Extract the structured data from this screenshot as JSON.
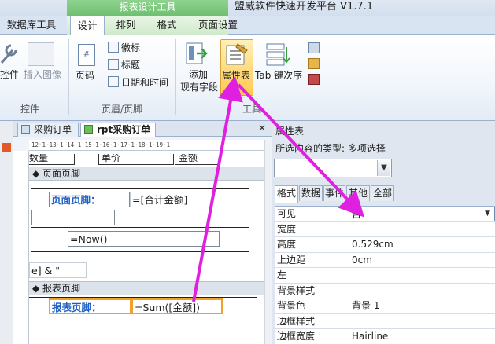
{
  "window": {
    "context_tab_group": "报表设计工具",
    "app_title": "盟威软件快速开发平台 V1.7.1"
  },
  "tabs": [
    {
      "label": "数据库工具"
    },
    {
      "label": "设计"
    },
    {
      "label": "排列"
    },
    {
      "label": "格式"
    },
    {
      "label": "页面设置"
    }
  ],
  "ribbon": {
    "controls_group": {
      "label": "控件",
      "items": [
        "控件",
        "插入图像"
      ]
    },
    "header_footer_group": {
      "label": "页眉/页脚",
      "page_number": "页码",
      "logo": "徽标",
      "title": "标题",
      "date_time": "日期和时间"
    },
    "tools_group": {
      "label": "工具",
      "add_field_line1": "添加",
      "add_field_line2": "现有字段",
      "property_sheet": "属性表",
      "tab_order": "Tab 键次序"
    }
  },
  "documents": {
    "tabs": [
      "采购订单",
      "rpt采购订单"
    ],
    "active": "rpt采购订单"
  },
  "design": {
    "ruler_text": "12·1·13·1·14·1·15·1·16·1·17·1·18·1·19·1·",
    "partial_header_labels": [
      "数量",
      "单价",
      "金额"
    ],
    "page_footer_band": "页面页脚",
    "page_footer_label": "页面页脚：",
    "page_footer_value": "=[合计金额]",
    "now_expr": "=Now()",
    "partial_expr": "e] & \"",
    "report_footer_band": "报表页脚",
    "report_footer_label": "报表页脚：",
    "report_footer_value": "=Sum([金额])"
  },
  "property_sheet": {
    "title": "属性表",
    "selection_type_label": "所选内容的类型: 多项选择",
    "tabs": [
      "格式",
      "数据",
      "事件",
      "其他",
      "全部"
    ],
    "rows": [
      {
        "name": "可见",
        "value": "否"
      },
      {
        "name": "宽度",
        "value": ""
      },
      {
        "name": "高度",
        "value": "0.529cm"
      },
      {
        "name": "上边距",
        "value": "0cm"
      },
      {
        "name": "左",
        "value": ""
      },
      {
        "name": "背景样式",
        "value": ""
      },
      {
        "name": "背景色",
        "value": "背景 1"
      },
      {
        "name": "边框样式",
        "value": ""
      },
      {
        "name": "边框宽度",
        "value": "Hairline"
      }
    ]
  },
  "colors": {
    "annotation_arrow": "#e020e0",
    "context_tab": "#7cc87d",
    "highlight_button": "#ffc94f"
  }
}
